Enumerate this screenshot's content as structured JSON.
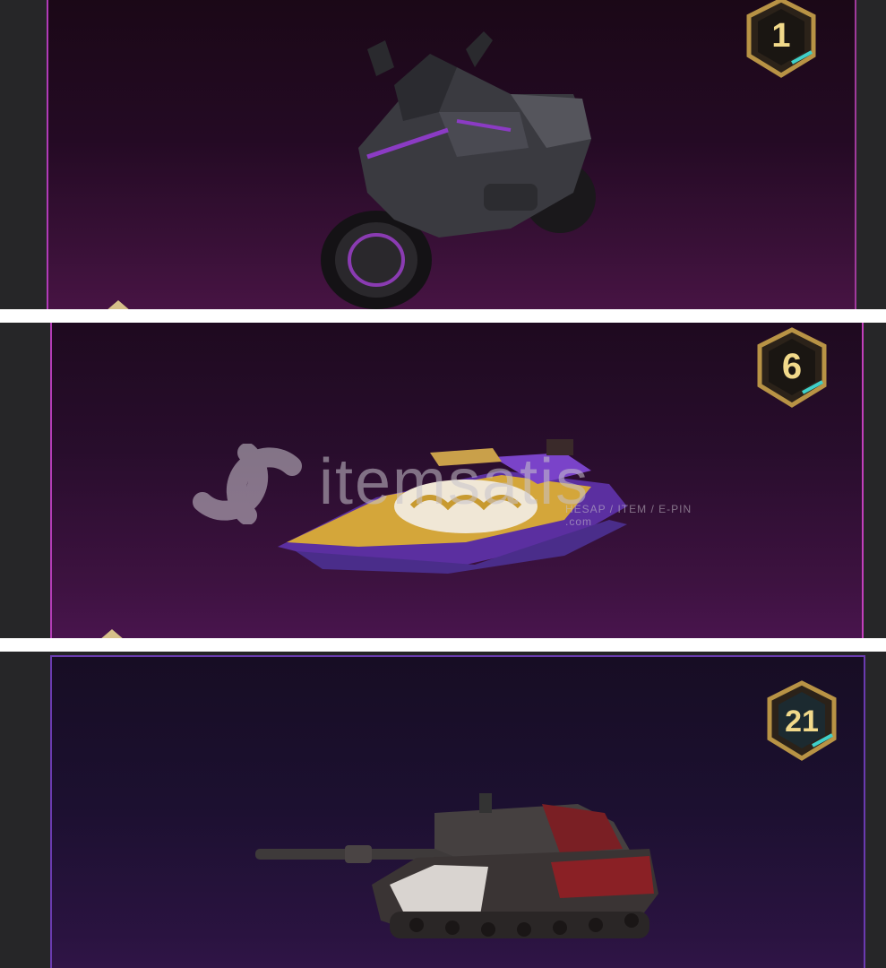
{
  "cards": [
    {
      "badge": "1",
      "item": "motorcycle-icon",
      "accent": "#b13bb8"
    },
    {
      "badge": "6",
      "item": "jet-ski-icon",
      "accent": "#c23fbb"
    },
    {
      "badge": "21",
      "item": "tank-icon",
      "accent": "#6a3bb0"
    }
  ],
  "watermark": {
    "brand": "itemsatis",
    "tagline": "HESAP / ITEM / E-PIN",
    "domain": ".com"
  }
}
